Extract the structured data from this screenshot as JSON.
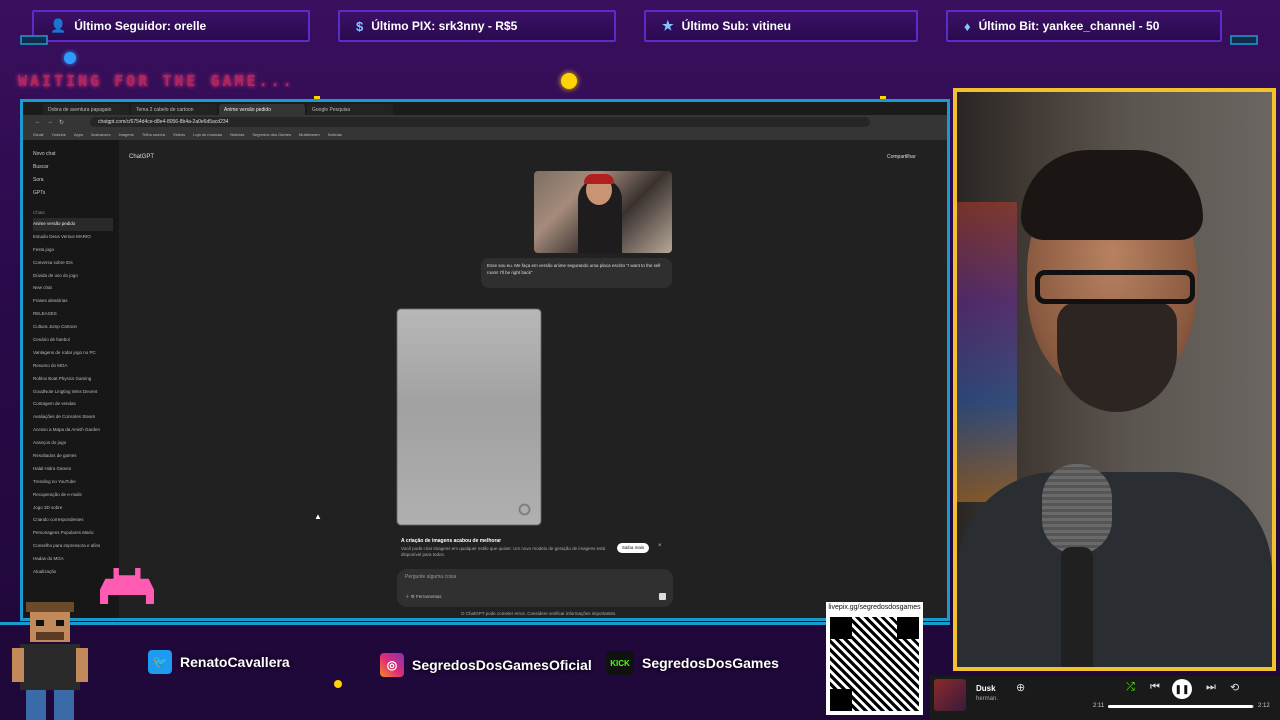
{
  "alerts": {
    "follower": "Último Seguidor: orelle",
    "pix": "Último PIX: srk3nny - R$5",
    "sub": "Último Sub: vitineu",
    "bit": "Último Bit: yankee_channel - 50"
  },
  "waiting_text": "WAITING FOR THE GAME...",
  "browser": {
    "tabs": [
      "Dobra de aventura papagaio",
      "Tema 2 cabelo de cartoon",
      "Anime versão pedido",
      "Google Pesquisa"
    ],
    "url": "chatgpt.com/c/6754d4ce-d8e4-8056-8b4a-2a0e6d5acd234",
    "bookmarks": [
      "Gmail",
      "Youtube",
      "Apps",
      "Ilustracoes",
      "Imagens",
      "Trilha sonora",
      "Videos",
      "Loja de musicas",
      "Noticias",
      "Segredos dos Games",
      "Multistream",
      "Noticias"
    ],
    "gpt": {
      "title": "ChatGPT",
      "share": "Compartilhar",
      "nav": [
        "Novo chat",
        "Buscar",
        "Sora",
        "GPTs"
      ],
      "section": "Chats",
      "chats": [
        "Anime versão pedido",
        "Estudio Deus Versus MARIO",
        "Festa jogo",
        "Conversa sobre IDs",
        "Dúvida de uso do jogo",
        "New chat",
        "Frases aleatórias",
        "RELEASES",
        "Cultura Jump Cartoon",
        "Cenário de futebol",
        "Vantagens de rodar jogo no PC",
        "Resumo do MGA",
        "Roblox Boat Physics Gaming",
        "GoodNote Lingting Wins Decent",
        "Contagem de vendas",
        "Avaliações de Consoles Steam",
        "Acesso a Mapa da Amish Garden",
        "Avanços do jogo",
        "Resultados de games",
        "Halal Hidra Games",
        "Trending no YouTube",
        "Recuperação de e-mails",
        "Jogo 3D sobre",
        "Criando correspondentes",
        "Personagens Populares Mario",
        "Conselho para impressora e afins",
        "Hadas do MGA",
        "Atualização"
      ],
      "user_message": "Esse sou eu. Me faça em versão anime segurando uma placa escrito \"I want to the sell room! I'll be right back\"",
      "notice_title": "A criação de imagens acabou de melhorar",
      "notice_body": "Você pode criar imagens em qualquer estilo que quiser. Um novo modelo de geração de imagens está disponível para todos.",
      "notice_button": "Saiba mais",
      "composer_placeholder": "Pergunte alguma coisa",
      "composer_tool": "Ferramentas",
      "footer": "O ChatGPT pode cometer erros. Considere verificar informações importantes."
    }
  },
  "socials": {
    "twitter": "RenatoCavallera",
    "instagram": "SegredosDosGamesOficial",
    "kick_badge": "KICK",
    "kick": "SegredosDosGames"
  },
  "qr_label": "livepix.gg/segredosdosgames",
  "player": {
    "title": "Dusk",
    "artist": "herman.",
    "elapsed": "2:11",
    "duration": "2:12",
    "progress": 0.99
  },
  "colors": {
    "accent_blue": "#1a9bd0",
    "webcam_border": "#f2c12e",
    "alert_border": "#5b2cc9"
  }
}
